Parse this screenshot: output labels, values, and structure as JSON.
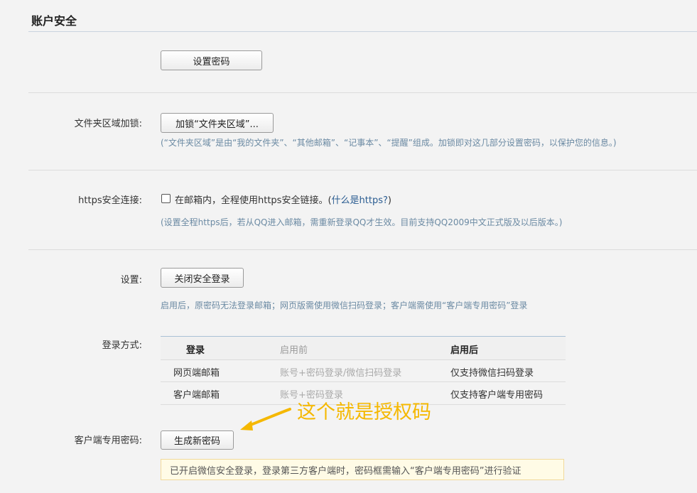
{
  "header": {
    "title": "账户安全"
  },
  "password": {
    "button": "设置密码"
  },
  "folder_lock": {
    "label": "文件夹区域加锁:",
    "button": "加锁“文件夹区域”...",
    "note": "(“文件夹区域”是由“我的文件夹”、“其他邮箱”、“记事本”、“提醒”组成。加锁即对这几部分设置密码，以保护您的信息。)"
  },
  "https": {
    "label": "https安全连接:",
    "checkbox_text": "在邮箱内，全程使用https安全链接。",
    "help_open": "(",
    "help_link": "什么是https?",
    "help_close": ")",
    "note": "(设置全程https后，若从QQ进入邮箱，需重新登录QQ才生效。目前支持QQ2009中文正式版及以后版本。)"
  },
  "settings": {
    "label": "设置:",
    "button": "关闭安全登录",
    "note": "启用后，原密码无法登录邮箱；网页版需使用微信扫码登录；客户端需使用“客户端专用密码”登录"
  },
  "login_method": {
    "label": "登录方式:",
    "columns": [
      "登录",
      "启用前",
      "启用后"
    ],
    "rows": [
      [
        "网页端邮箱",
        "账号+密码登录/微信扫码登录",
        "仅支持微信扫码登录"
      ],
      [
        "客户端邮箱",
        "账号+密码登录",
        "仅支持客户端专用密码"
      ]
    ]
  },
  "client_password": {
    "label": "客户端专用密码:",
    "button": "生成新密码",
    "tip": "已开启微信安全登录，登录第三方客户端时，密码框需输入“客户端专用密码”进行验证"
  },
  "annotation": {
    "text": "这个就是授权码",
    "color": "#f5b800"
  }
}
